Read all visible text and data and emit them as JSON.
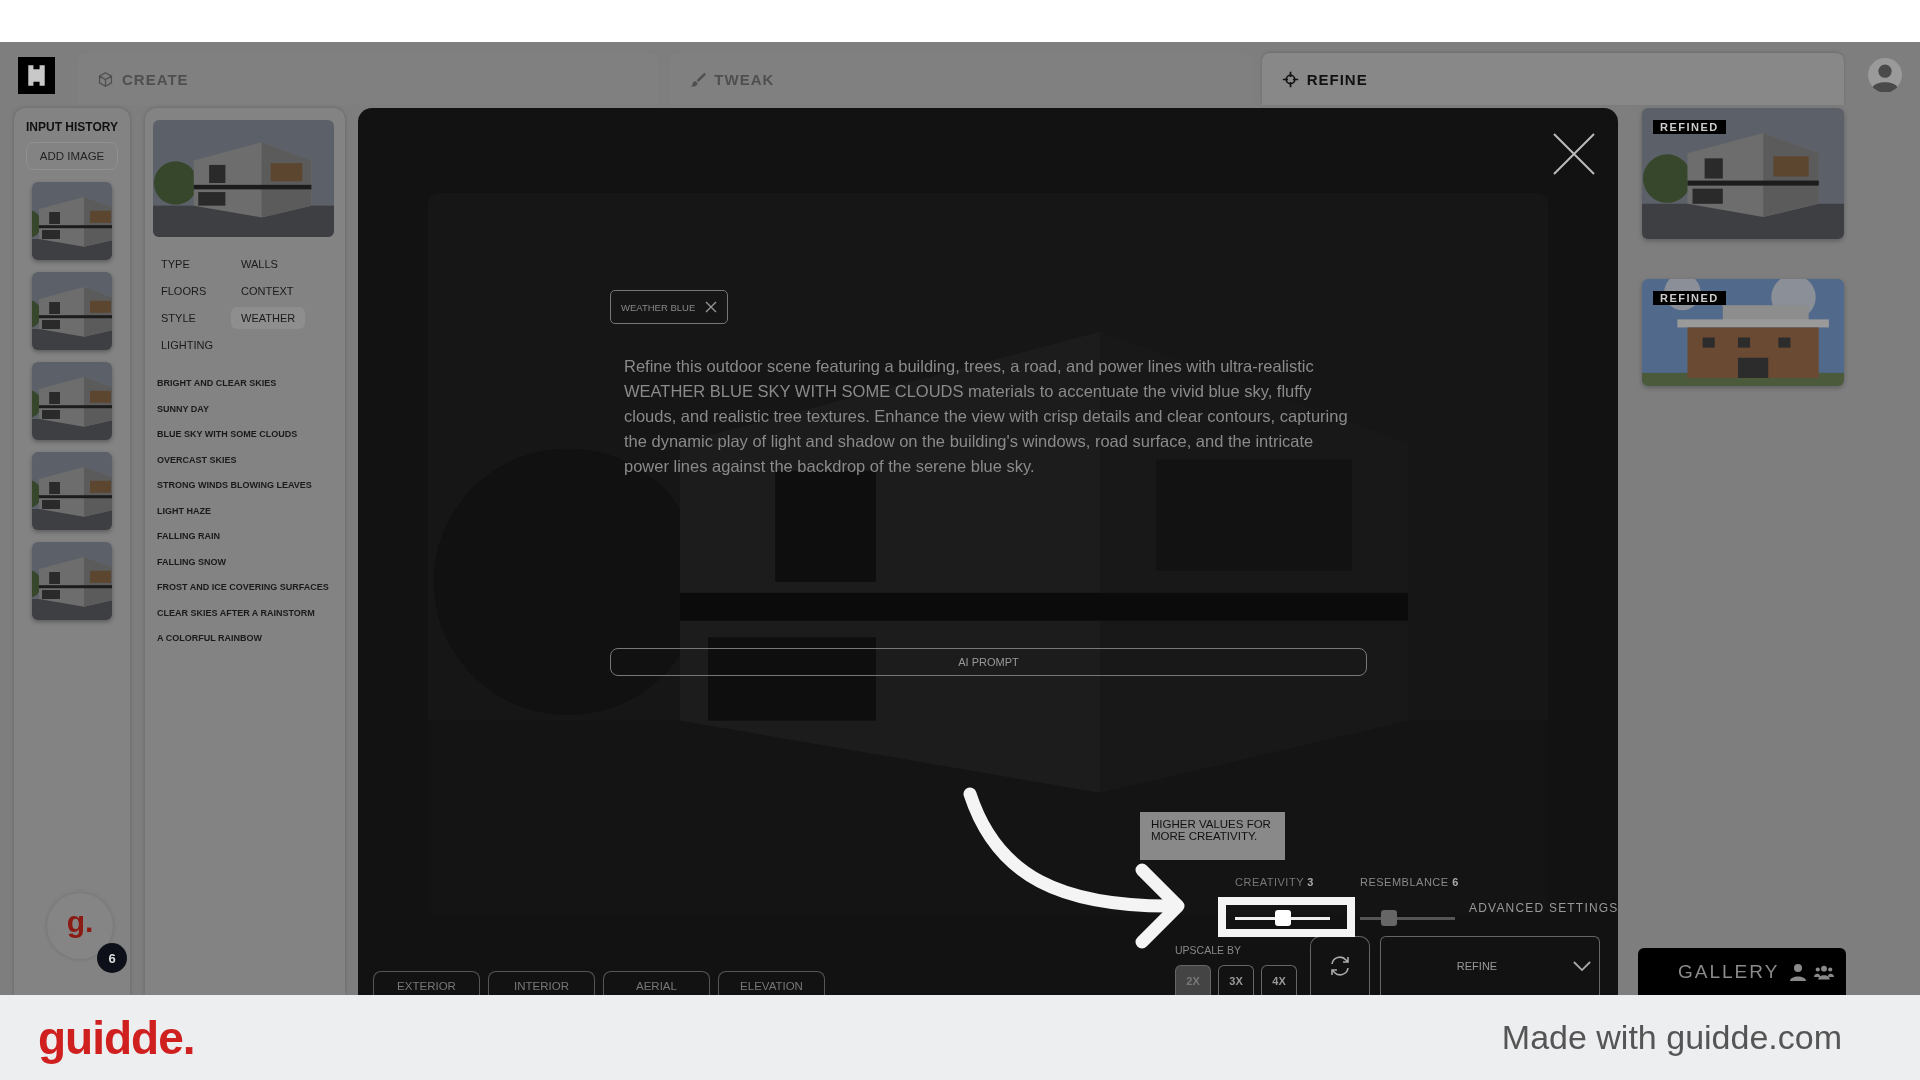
{
  "tabs": [
    {
      "label": "CREATE",
      "selected": false
    },
    {
      "label": "TWEAK",
      "selected": false
    },
    {
      "label": "REFINE",
      "selected": true
    }
  ],
  "input_history": {
    "title": "INPUT HISTORY",
    "add_button": "ADD IMAGE"
  },
  "categories": [
    {
      "label": "TYPE",
      "selected": false
    },
    {
      "label": "WALLS",
      "selected": false
    },
    {
      "label": "FLOORS",
      "selected": false
    },
    {
      "label": "CONTEXT",
      "selected": false
    },
    {
      "label": "STYLE",
      "selected": false
    },
    {
      "label": "WEATHER",
      "selected": true
    },
    {
      "label": "LIGHTING",
      "selected": false
    }
  ],
  "options": [
    "BRIGHT AND CLEAR SKIES",
    "SUNNY DAY",
    "BLUE SKY WITH SOME CLOUDS",
    "OVERCAST SKIES",
    "STRONG WINDS BLOWING LEAVES",
    "LIGHT HAZE",
    "FALLING RAIN",
    "FALLING SNOW",
    "FROST AND ICE COVERING SURFACES",
    "CLEAR SKIES AFTER A RAINSTORM",
    "A COLORFUL RAINBOW"
  ],
  "modal": {
    "tag": "WEATHER BLUE",
    "prompt": "Refine this outdoor scene featuring a building, trees, a road, and power lines with ultra-realistic WEATHER BLUE SKY WITH SOME CLOUDS materials to accentuate the vivid blue sky, fluffy clouds, and realistic tree textures. Enhance the view with crisp details and clear contours, capturing the dynamic play of light and shadow on the building's windows, road surface, and the intricate power lines against the backdrop of the serene blue sky.",
    "ai_prompt_button": "AI PROMPT",
    "view_buttons": [
      "EXTERIOR",
      "INTERIOR",
      "AERIAL",
      "ELEVATION"
    ],
    "sliders": [
      {
        "label": "CREATIVITY",
        "value": "3",
        "level": 0.5,
        "highlighted": true
      },
      {
        "label": "RESEMBLANCE",
        "value": "6",
        "level": 0.3,
        "highlighted": false
      }
    ],
    "advanced_settings": "ADVANCED SETTINGS",
    "upscale": {
      "label": "UPSCALE BY",
      "options": [
        {
          "label": "2X",
          "selected": true
        },
        {
          "label": "3X",
          "selected": false
        },
        {
          "label": "4X",
          "selected": false
        }
      ]
    },
    "refine_button": "REFINE"
  },
  "results": [
    {
      "badge": "REFINED",
      "kind": "picture"
    },
    {
      "badge": "REFINED",
      "kind": "picture"
    }
  ],
  "gallery_button": "GALLERY",
  "guide": {
    "tooltip": "HIGHER VALUES FOR MORE CREATIVITY.",
    "help_badge": "6",
    "help_letter": "g.",
    "brand": "guidde.",
    "footer": "Made with guidde.com"
  }
}
